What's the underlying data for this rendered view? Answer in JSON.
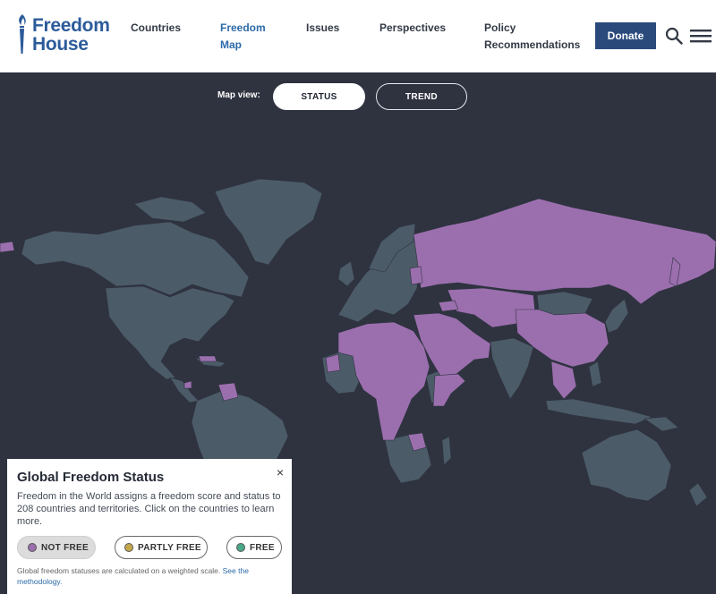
{
  "header": {
    "logo_line1": "Freedom",
    "logo_line2": "House",
    "nav": [
      {
        "label": "Countries"
      },
      {
        "label_line1": "Freedom",
        "label_line2": "Map"
      },
      {
        "label": "Issues"
      },
      {
        "label": "Perspectives"
      },
      {
        "label_line1": "Policy",
        "label_line2": "Recommendations"
      }
    ],
    "donate_label": "Donate"
  },
  "map_view": {
    "label": "Map view:",
    "status_label": "STATUS",
    "trend_label": "TREND",
    "selected": "STATUS"
  },
  "legend": {
    "close_label": "×",
    "title": "Global Freedom Status",
    "description": "Freedom in the World assigns a freedom score and status to 208 countries and territories. Click on the countries to learn more.",
    "pills": [
      {
        "label": "NOT FREE",
        "color": "#9b6fae"
      },
      {
        "label": "PARTLY FREE",
        "color": "#c3a84b"
      },
      {
        "label": "FREE",
        "color": "#4aa88a"
      }
    ],
    "footnote_text": "Global freedom statuses are calculated on a weighted scale. ",
    "footnote_link": "See the methodology."
  },
  "colors": {
    "background": "#2f3340",
    "land_other": "#4c5b68",
    "land_not_free": "#9b6fae",
    "brand": "#2c5b9a",
    "donate": "#2a4a7c"
  }
}
